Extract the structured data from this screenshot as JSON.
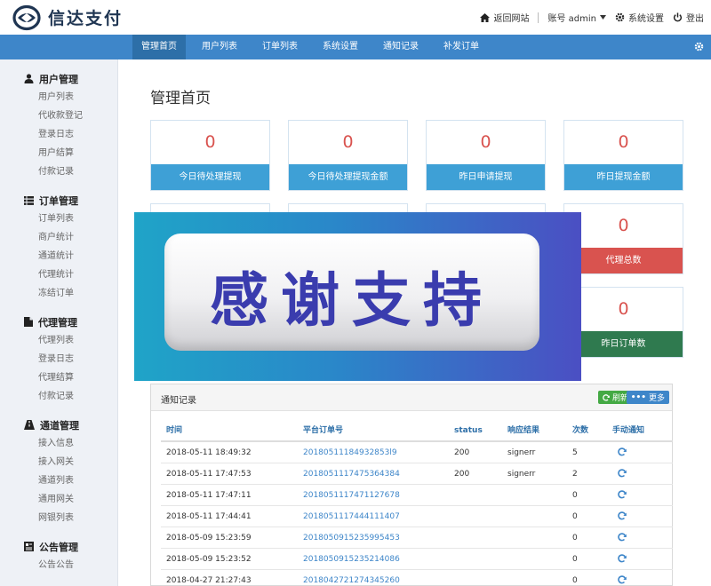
{
  "brand": {
    "name": "信达支付"
  },
  "header": {
    "home_label": "返回网站",
    "account_label": "账号 admin",
    "settings_label": "系统设置",
    "logout_label": "登出"
  },
  "nav": {
    "items": [
      {
        "label": "管理首页"
      },
      {
        "label": "用户列表"
      },
      {
        "label": "订单列表"
      },
      {
        "label": "系统设置"
      },
      {
        "label": "通知记录"
      },
      {
        "label": "补发订单"
      }
    ]
  },
  "sidebar": {
    "groups": [
      {
        "title": "用户管理",
        "icon": "user-icon",
        "items": [
          "用户列表",
          "代收款登记",
          "登录日志",
          "用户结算",
          "付款记录"
        ]
      },
      {
        "title": "订单管理",
        "icon": "list-icon",
        "items": [
          "订单列表",
          "商户统计",
          "通道统计",
          "代理统计",
          "冻结订单"
        ]
      },
      {
        "title": "代理管理",
        "icon": "file-icon",
        "items": [
          "代理列表",
          "登录日志",
          "代理结算",
          "付款记录"
        ]
      },
      {
        "title": "通道管理",
        "icon": "road-icon",
        "items": [
          "接入信息",
          "接入网关",
          "通道列表",
          "通用网关",
          "网银列表"
        ]
      },
      {
        "title": "公告管理",
        "icon": "notice-icon",
        "items": [
          "公告公告"
        ]
      }
    ]
  },
  "page": {
    "title": "管理首页"
  },
  "stats_row1": [
    {
      "value": "0",
      "label": "今日待处理提现"
    },
    {
      "value": "0",
      "label": "今日待处理提现金额"
    },
    {
      "value": "0",
      "label": "昨日申请提现"
    },
    {
      "value": "0",
      "label": "昨日提现金额"
    }
  ],
  "stats_side": [
    {
      "value": "0",
      "label": "代理总数"
    },
    {
      "value": "0",
      "label": "昨日订单数"
    }
  ],
  "banner": {
    "text": "感谢支持"
  },
  "notices": {
    "title": "通知记录",
    "refresh_label": "刷新",
    "more_label": "更多",
    "columns": [
      "时间",
      "平台订单号",
      "status",
      "响应结果",
      "次数",
      "手动通知"
    ],
    "rows": [
      {
        "time": "2018-05-11 18:49:32",
        "order": "20180511184932853l9",
        "status": "200",
        "result": "signerr",
        "count": "5"
      },
      {
        "time": "2018-05-11 17:47:53",
        "order": "2018051117475364384",
        "status": "200",
        "result": "signerr",
        "count": "2"
      },
      {
        "time": "2018-05-11 17:47:11",
        "order": "2018051117471127678",
        "status": "",
        "result": "",
        "count": "0"
      },
      {
        "time": "2018-05-11 17:44:41",
        "order": "2018051117444111407",
        "status": "",
        "result": "",
        "count": "0"
      },
      {
        "time": "2018-05-09 15:23:59",
        "order": "2018050915235995453",
        "status": "",
        "result": "",
        "count": "0"
      },
      {
        "time": "2018-05-09 15:23:52",
        "order": "2018050915235214086",
        "status": "",
        "result": "",
        "count": "0"
      },
      {
        "time": "2018-04-27 21:27:43",
        "order": "2018042721274345260",
        "status": "",
        "result": "",
        "count": "0"
      }
    ]
  },
  "colors": {
    "nav": "#3e86c9",
    "card_label": "#3ea0d6",
    "danger": "#d9534f",
    "success_dark": "#2f7a4f"
  }
}
